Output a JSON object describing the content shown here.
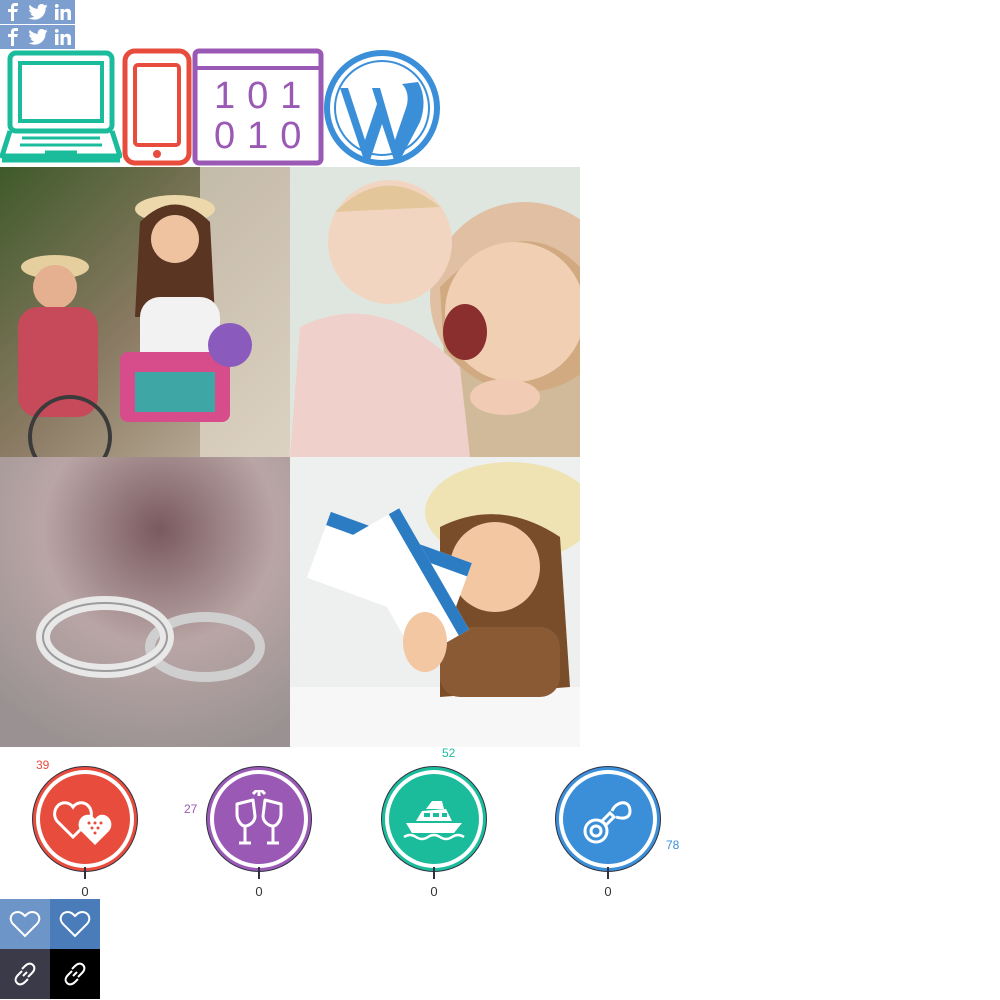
{
  "share": {
    "row1": [
      "facebook-icon",
      "twitter-icon",
      "linkedin-icon"
    ],
    "row2": [
      "facebook-icon",
      "twitter-icon",
      "linkedin-icon"
    ]
  },
  "icons": {
    "binary_line1": "101",
    "binary_line2": "010"
  },
  "colors": {
    "teal": "#1abc9c",
    "red": "#e74c3c",
    "purple": "#9b59b6",
    "blue": "#3a8fd8"
  },
  "stats": [
    {
      "percent": "39",
      "count": "0",
      "icon": "hearts-icon"
    },
    {
      "percent": "27",
      "count": "0",
      "icon": "champagne-glasses-icon"
    },
    {
      "percent": "52",
      "count": "0",
      "icon": "yacht-icon"
    },
    {
      "percent": "78",
      "count": "0",
      "icon": "pacifier-icon"
    }
  ],
  "actions": [
    "heart-icon",
    "heart-icon",
    "link-icon",
    "link-icon"
  ]
}
